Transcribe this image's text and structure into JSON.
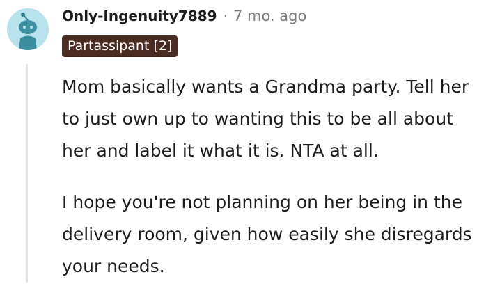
{
  "comment": {
    "username": "Only-Ingenuity7889",
    "separator": "·",
    "timestamp": "7 mo. ago",
    "flair": "Partassipant [2]",
    "avatar_icon": "snoo-avatar-icon",
    "paragraphs": [
      "Mom basically wants a Grandma party. Tell her to just own up to wanting this to be all about her and label it what it is. NTA at all.",
      "I hope you're not planning on her being in the delivery room, given how easily she disregards your needs."
    ]
  },
  "colors": {
    "avatar_bg": "#b8e3ec",
    "avatar_figure": "#3d8ea0",
    "flair_bg": "#4b2c22",
    "flair_text": "#ffffff",
    "text": "#1c1c1c",
    "meta": "#7c7c7c",
    "thread_line": "#e3e3e3"
  }
}
